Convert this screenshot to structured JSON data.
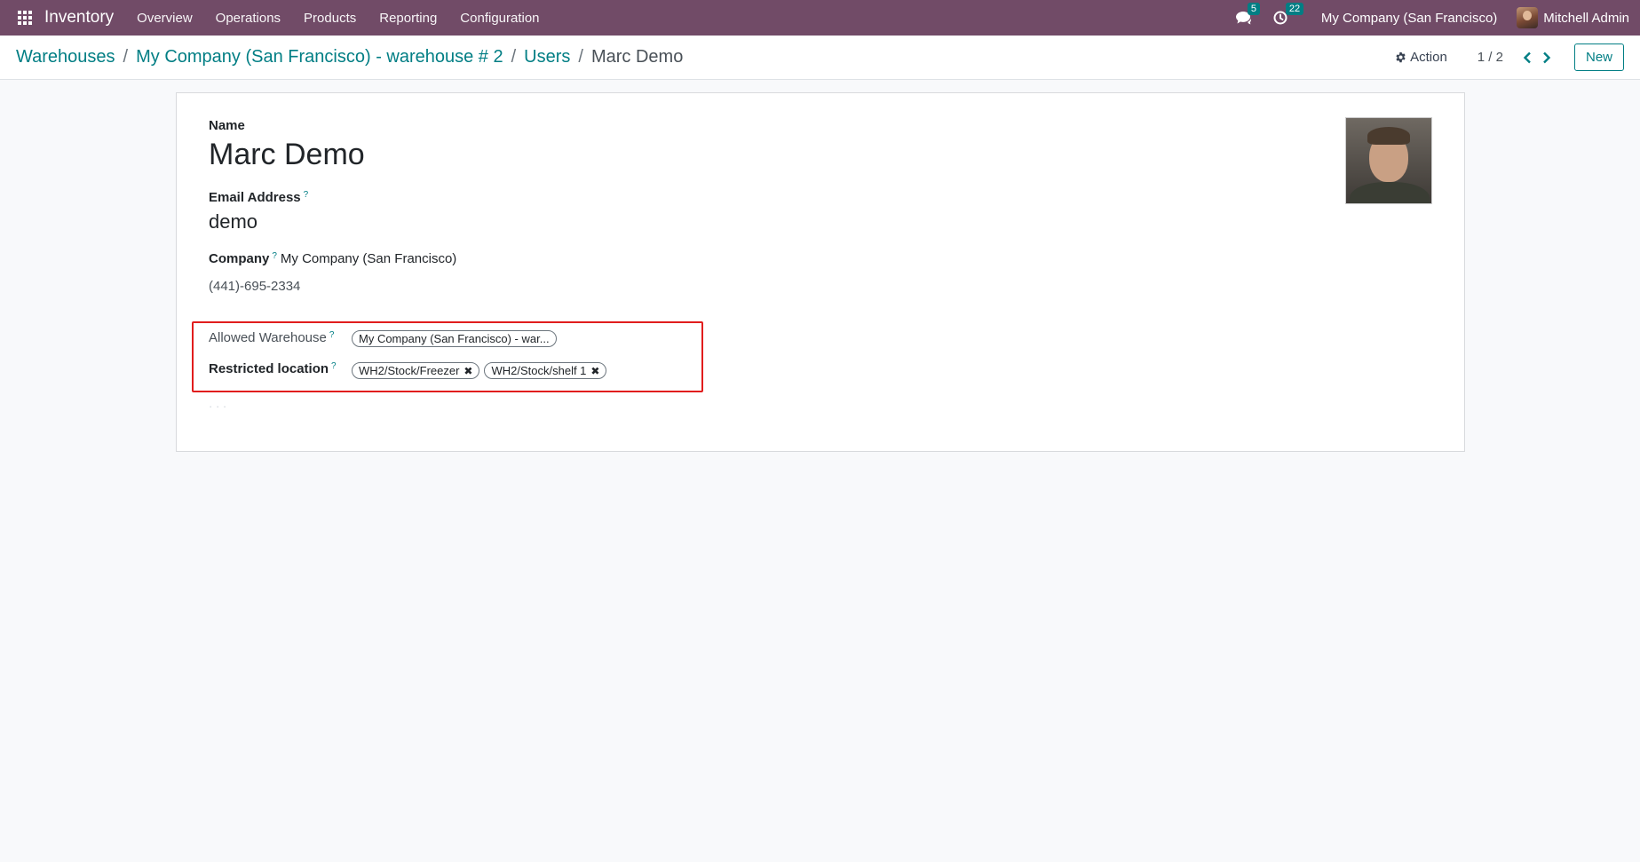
{
  "navbar": {
    "brand": "Inventory",
    "menu": [
      "Overview",
      "Operations",
      "Products",
      "Reporting",
      "Configuration"
    ],
    "messages_count": "5",
    "activities_count": "22",
    "company": "My Company (San Francisco)",
    "user": "Mitchell Admin"
  },
  "breadcrumb": {
    "items": [
      "Warehouses",
      "My Company (San Francisco) - warehouse # 2",
      "Users"
    ],
    "current": "Marc Demo"
  },
  "control": {
    "action_label": "Action",
    "pager": "1 / 2",
    "new_label": "New"
  },
  "form": {
    "name_label": "Name",
    "name_value": "Marc Demo",
    "email_label": "Email Address",
    "email_value": "demo",
    "company_label": "Company",
    "company_value": "My Company (San Francisco)",
    "phone": "(441)-695-2334",
    "help_mark": "?",
    "allowed_warehouse_label": "Allowed Warehouse",
    "allowed_warehouse_tags": [
      "My Company (San Francisco) - war..."
    ],
    "restricted_location_label": "Restricted location",
    "restricted_location_tags": [
      "WH2/Stock/Freezer",
      "WH2/Stock/shelf 1"
    ]
  },
  "colors": {
    "navbar": "#714b67",
    "accent": "#017e84",
    "highlight": "#e11d1d"
  }
}
